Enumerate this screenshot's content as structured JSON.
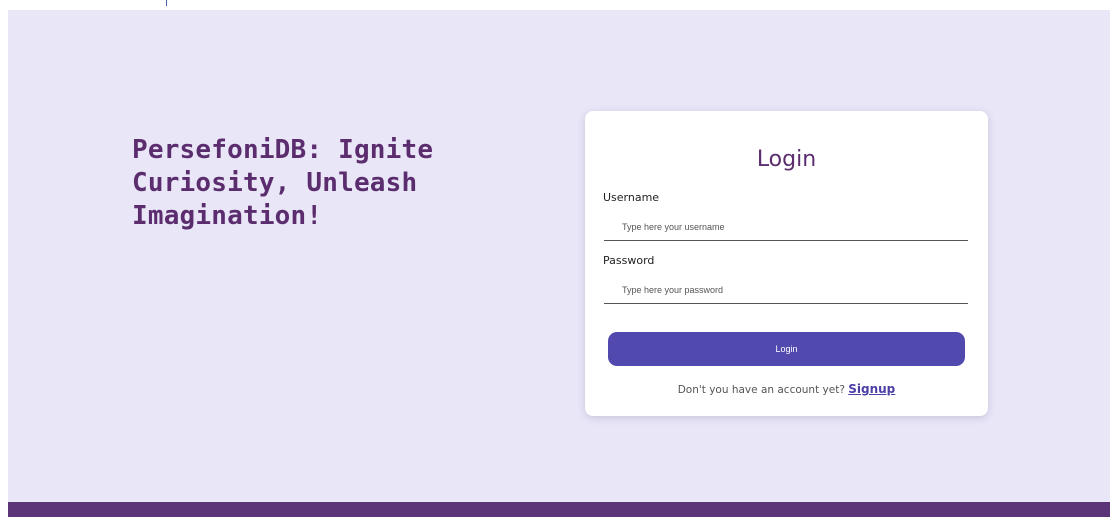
{
  "hero": {
    "tagline": "PersefoniDB: Ignite Curiosity, Unleash Imagination!"
  },
  "login_form": {
    "title": "Login",
    "username_label": "Username",
    "username_placeholder": "Type here your username",
    "username_value": "",
    "password_label": "Password",
    "password_placeholder": "Type here your password",
    "password_value": "",
    "submit_label": "Login",
    "signup_prompt": "Don't you have an account yet?",
    "signup_link_label": "Signup"
  },
  "colors": {
    "background": "#e8e6f7",
    "brand_purple": "#5b2d6e",
    "button": "#5149ad",
    "footer": "#5b3577"
  }
}
